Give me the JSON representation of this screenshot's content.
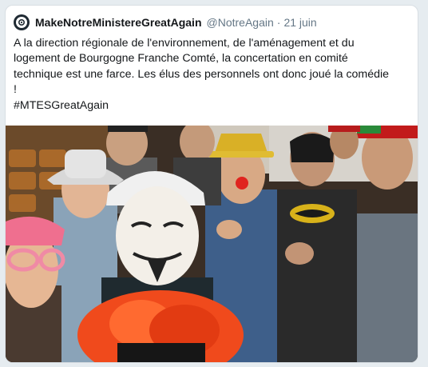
{
  "tweet": {
    "display_name": "MakeNotreMinistereGreatAgain",
    "handle": "@NotreAgain",
    "separator": "·",
    "date": "21 juin",
    "avatar_icon": "gear-logo-icon",
    "text_lines": [
      "A la direction régionale de l'environnement, de l'aménagement et du",
      "logement de Bourgogne Franche Comté, la concertation en comité",
      "technique est une farce. Les élus des personnels ont donc joué la comédie",
      "!"
    ],
    "hashtag": "#MTESGreatAgain"
  },
  "colors": {
    "card_border": "#d8dee3",
    "page_bg": "#e6ecf0",
    "text": "#14171a",
    "muted": "#657786"
  }
}
